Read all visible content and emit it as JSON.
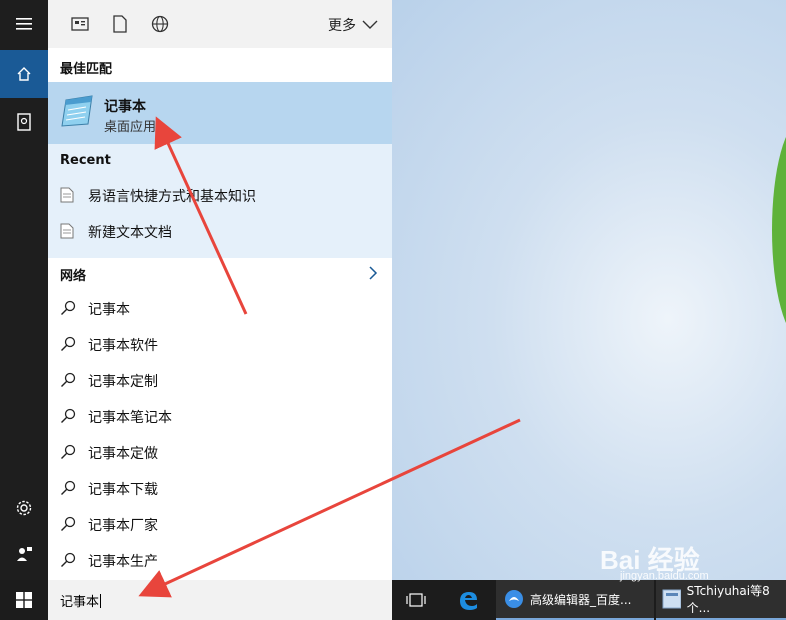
{
  "top_bar": {
    "more_label": "更多",
    "icons": [
      "apps-filter-icon",
      "documents-filter-icon",
      "web-filter-icon"
    ]
  },
  "best_match": {
    "section_title": "最佳匹配",
    "app_name": "记事本",
    "app_type": "桌面应用"
  },
  "recent": {
    "section_title": "Recent",
    "items": [
      {
        "label": "易语言快捷方式和基本知识"
      },
      {
        "label": "新建文本文档"
      }
    ]
  },
  "web": {
    "section_title": "网络",
    "suggestions": [
      {
        "label": "记事本"
      },
      {
        "label": "记事本软件"
      },
      {
        "label": "记事本定制"
      },
      {
        "label": "记事本笔记本"
      },
      {
        "label": "记事本定做"
      },
      {
        "label": "记事本下载"
      },
      {
        "label": "记事本厂家"
      },
      {
        "label": "记事本生产"
      }
    ]
  },
  "search": {
    "query": "记事本"
  },
  "taskbar": {
    "apps": [
      {
        "label": "高级编辑器_百度..."
      },
      {
        "label": "STchiyuhai等8个..."
      }
    ]
  },
  "watermark": {
    "brand": "Bai  经验",
    "url": "jingyan.baidu.com"
  },
  "colors": {
    "accent": "#1a5a96",
    "best_match_bg": "#b7d6ef",
    "recent_bg": "#e5f0fa",
    "annotation_arrow": "#e8453c"
  }
}
